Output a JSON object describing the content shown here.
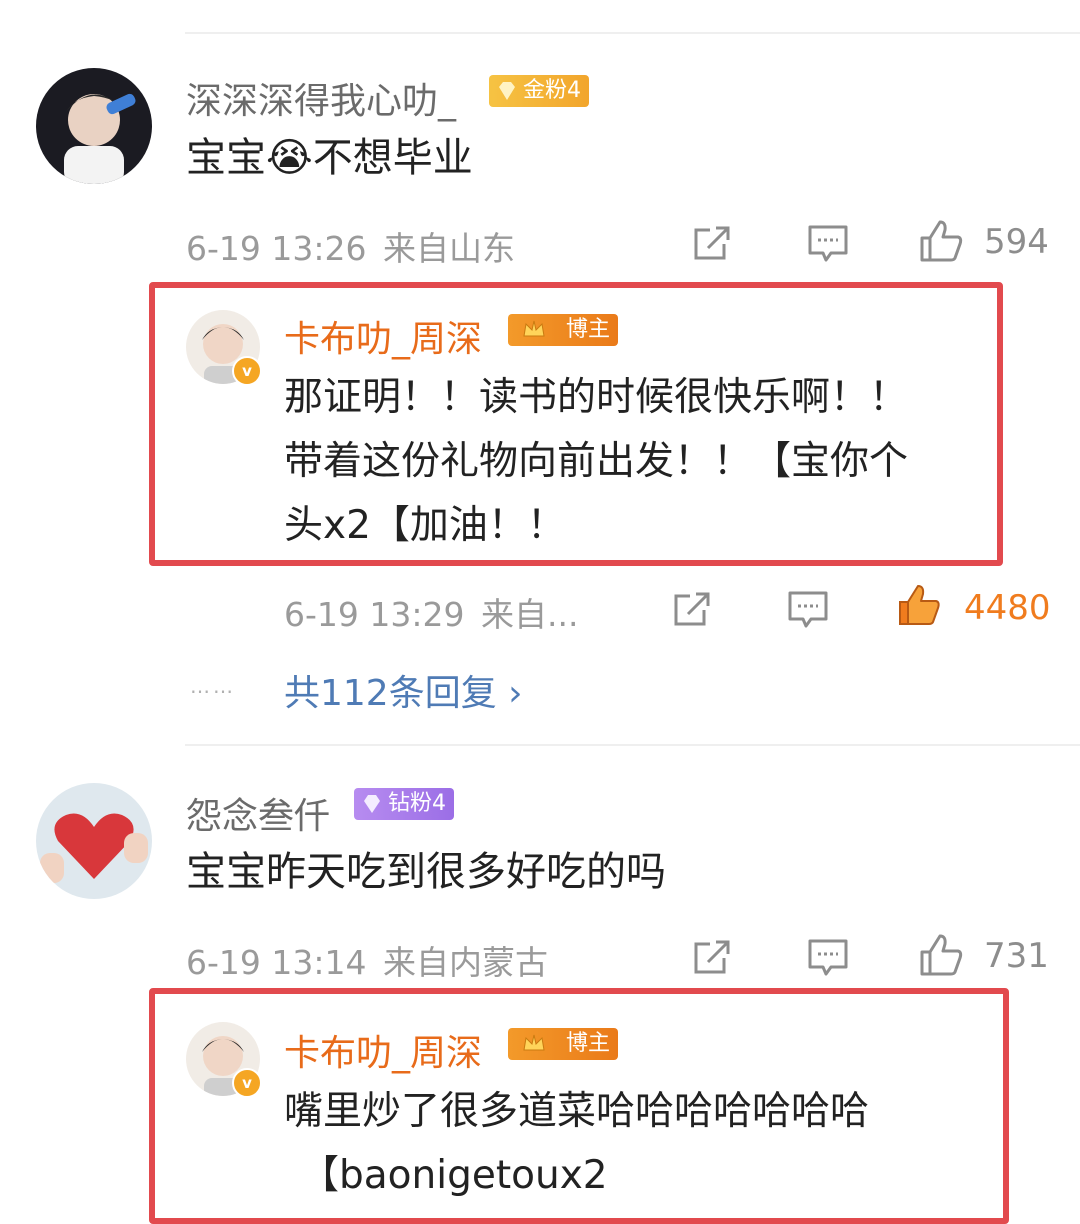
{
  "comments": [
    {
      "user": "深深深得我心叻_",
      "badge": "金粉4",
      "text_pre": "宝宝",
      "emoji": "😭",
      "text_post": "不想毕业",
      "time": "6-19 13:26",
      "location": "来自山东",
      "likes": "594",
      "reply": {
        "user": "卡布叻_周深",
        "badge": "博主",
        "lines": [
          "那证明！！读书的时候很快乐啊！！",
          "带着这份礼物向前出发！！【宝你个",
          "头x2【加油！！"
        ],
        "time": "6-19 13:29",
        "location": "来自...",
        "likes": "4480"
      },
      "more": {
        "dots": "……",
        "label": "共112条回复 ›"
      }
    },
    {
      "user": "怨念叁仟",
      "badge": "钻粉4",
      "text": "宝宝昨天吃到很多好吃的吗",
      "time": "6-19 13:14",
      "location": "来自内蒙古",
      "likes": "731",
      "reply": {
        "user": "卡布叻_周深",
        "badge": "博主",
        "lines": [
          "嘴里炒了很多道菜哈哈哈哈哈哈哈",
          "【baonigetoux2"
        ]
      }
    }
  ],
  "icons": {
    "share": "share-icon",
    "comment": "comment-icon",
    "like": "thumbs-up-icon",
    "verified": "verified-v-icon",
    "crown": "crown-icon"
  },
  "colors": {
    "highlight_border": "#e24a4e",
    "blogger_name": "#e86b1a",
    "liked": "#f07c1e",
    "link": "#4f7bb5"
  }
}
